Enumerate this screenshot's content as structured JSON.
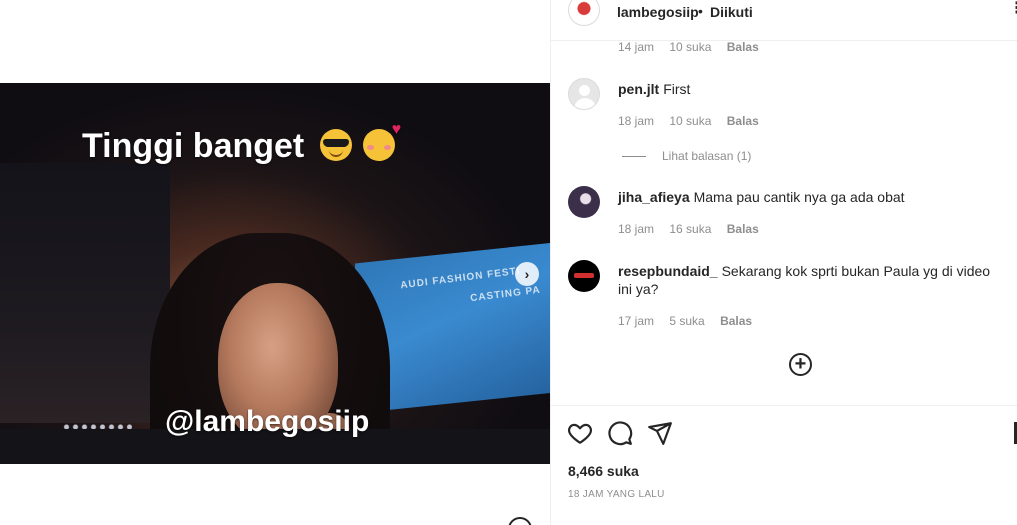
{
  "media": {
    "caption": "Tinggi banget",
    "caption_emojis": [
      "sunglasses-emoji",
      "smiling-hearts-emoji"
    ],
    "watermark": "@lambegosiip",
    "next_icon": "chevron-right-icon",
    "banner_text_1": "AUDI FASHION FESTI",
    "banner_text_2": "CASTING PA"
  },
  "post": {
    "username": "lambegosiip",
    "separator": "•",
    "follow_status": "Diikuti",
    "more_icon": "more-icon"
  },
  "top_meta": {
    "time": "14 jam",
    "likes": "10 suka",
    "reply": "Balas"
  },
  "comments": [
    {
      "user": "pen.jlt",
      "text": "First",
      "time": "18 jam",
      "likes": "10 suka",
      "reply": "Balas",
      "avatar": "default-avatar"
    },
    {
      "user": "jiha_afieya",
      "text": "Mama pau cantik nya ga ada obat",
      "time": "18 jam",
      "likes": "16 suka",
      "reply": "Balas",
      "avatar": "photo-avatar"
    },
    {
      "user": "resepbundaid_",
      "text": "Sekarang kok sprti bukan Paula yg di video ini ya?",
      "time": "17 jam",
      "likes": "5 suka",
      "reply": "Balas",
      "avatar": "logo-avatar"
    }
  ],
  "view_replies": "Lihat balasan (1)",
  "actions": {
    "like_icon": "heart-icon",
    "comment_icon": "comment-icon",
    "share_icon": "share-icon",
    "add_icon": "plus-circle-icon"
  },
  "likes_count": "8,466 suka",
  "time_ago": "18 JAM YANG LALU"
}
